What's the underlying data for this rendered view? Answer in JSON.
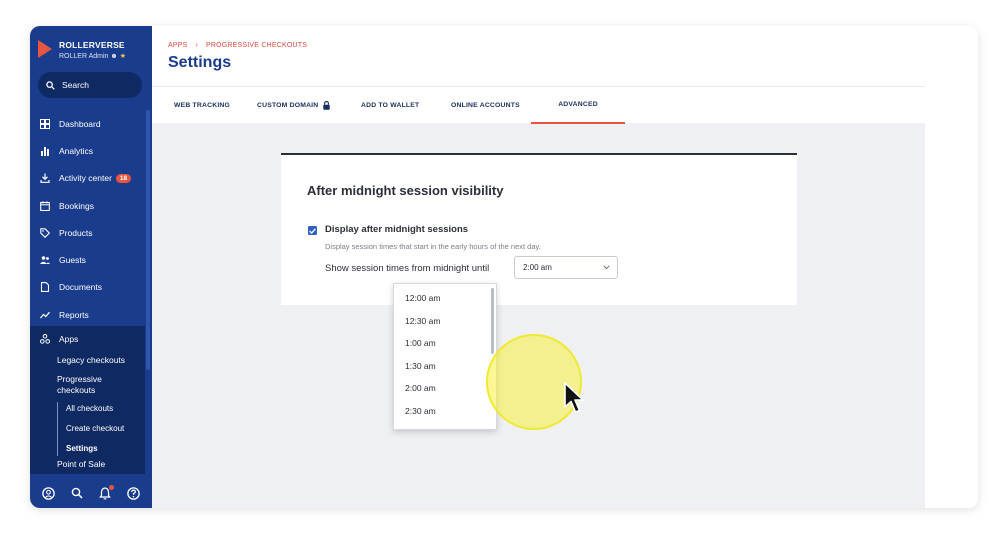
{
  "brand": {
    "name": "ROLLERVERSE",
    "subtitle": "ROLLER Admin"
  },
  "search": {
    "label": "Search"
  },
  "sidebar": {
    "items": [
      {
        "label": "Dashboard",
        "icon": "dashboard-icon"
      },
      {
        "label": "Analytics",
        "icon": "analytics-icon"
      },
      {
        "label": "Activity center",
        "icon": "download-icon",
        "badge": "18"
      },
      {
        "label": "Bookings",
        "icon": "calendar-icon"
      },
      {
        "label": "Products",
        "icon": "tag-icon"
      },
      {
        "label": "Guests",
        "icon": "guests-icon"
      },
      {
        "label": "Documents",
        "icon": "document-icon"
      },
      {
        "label": "Reports",
        "icon": "trend-icon"
      }
    ],
    "apps": {
      "label": "Apps",
      "children": {
        "legacy": "Legacy checkouts",
        "progressive": "Progressive checkouts",
        "all": "All checkouts",
        "create": "Create checkout",
        "settings": "Settings",
        "pos": "Point of Sale"
      }
    }
  },
  "breadcrumb": {
    "apps": "APPS",
    "current": "PROGRESSIVE CHECKOUTS"
  },
  "page": {
    "title": "Settings"
  },
  "tabs": [
    {
      "label": "WEB TRACKING"
    },
    {
      "label": "CUSTOM DOMAIN"
    },
    {
      "label": "ADD TO WALLET"
    },
    {
      "label": "ONLINE ACCOUNTS"
    },
    {
      "label": "ADVANCED"
    }
  ],
  "card": {
    "title": "After midnight session visibility",
    "checkbox_label": "Display after midnight sessions",
    "checkbox_checked": true,
    "description": "Display session times that start in the early hours of the next day.",
    "until_label": "Show session times from midnight until",
    "select_value": "2:00 am"
  },
  "dropdown": {
    "options": [
      "12:00 am",
      "12:30 am",
      "1:00 am",
      "1:30 am",
      "2:00 am",
      "2:30 am"
    ]
  },
  "colors": {
    "sidebar": "#1a3c8c",
    "accent": "#e8553e",
    "checkbox": "#2f5fc8",
    "highlight": "#f5f03c"
  }
}
